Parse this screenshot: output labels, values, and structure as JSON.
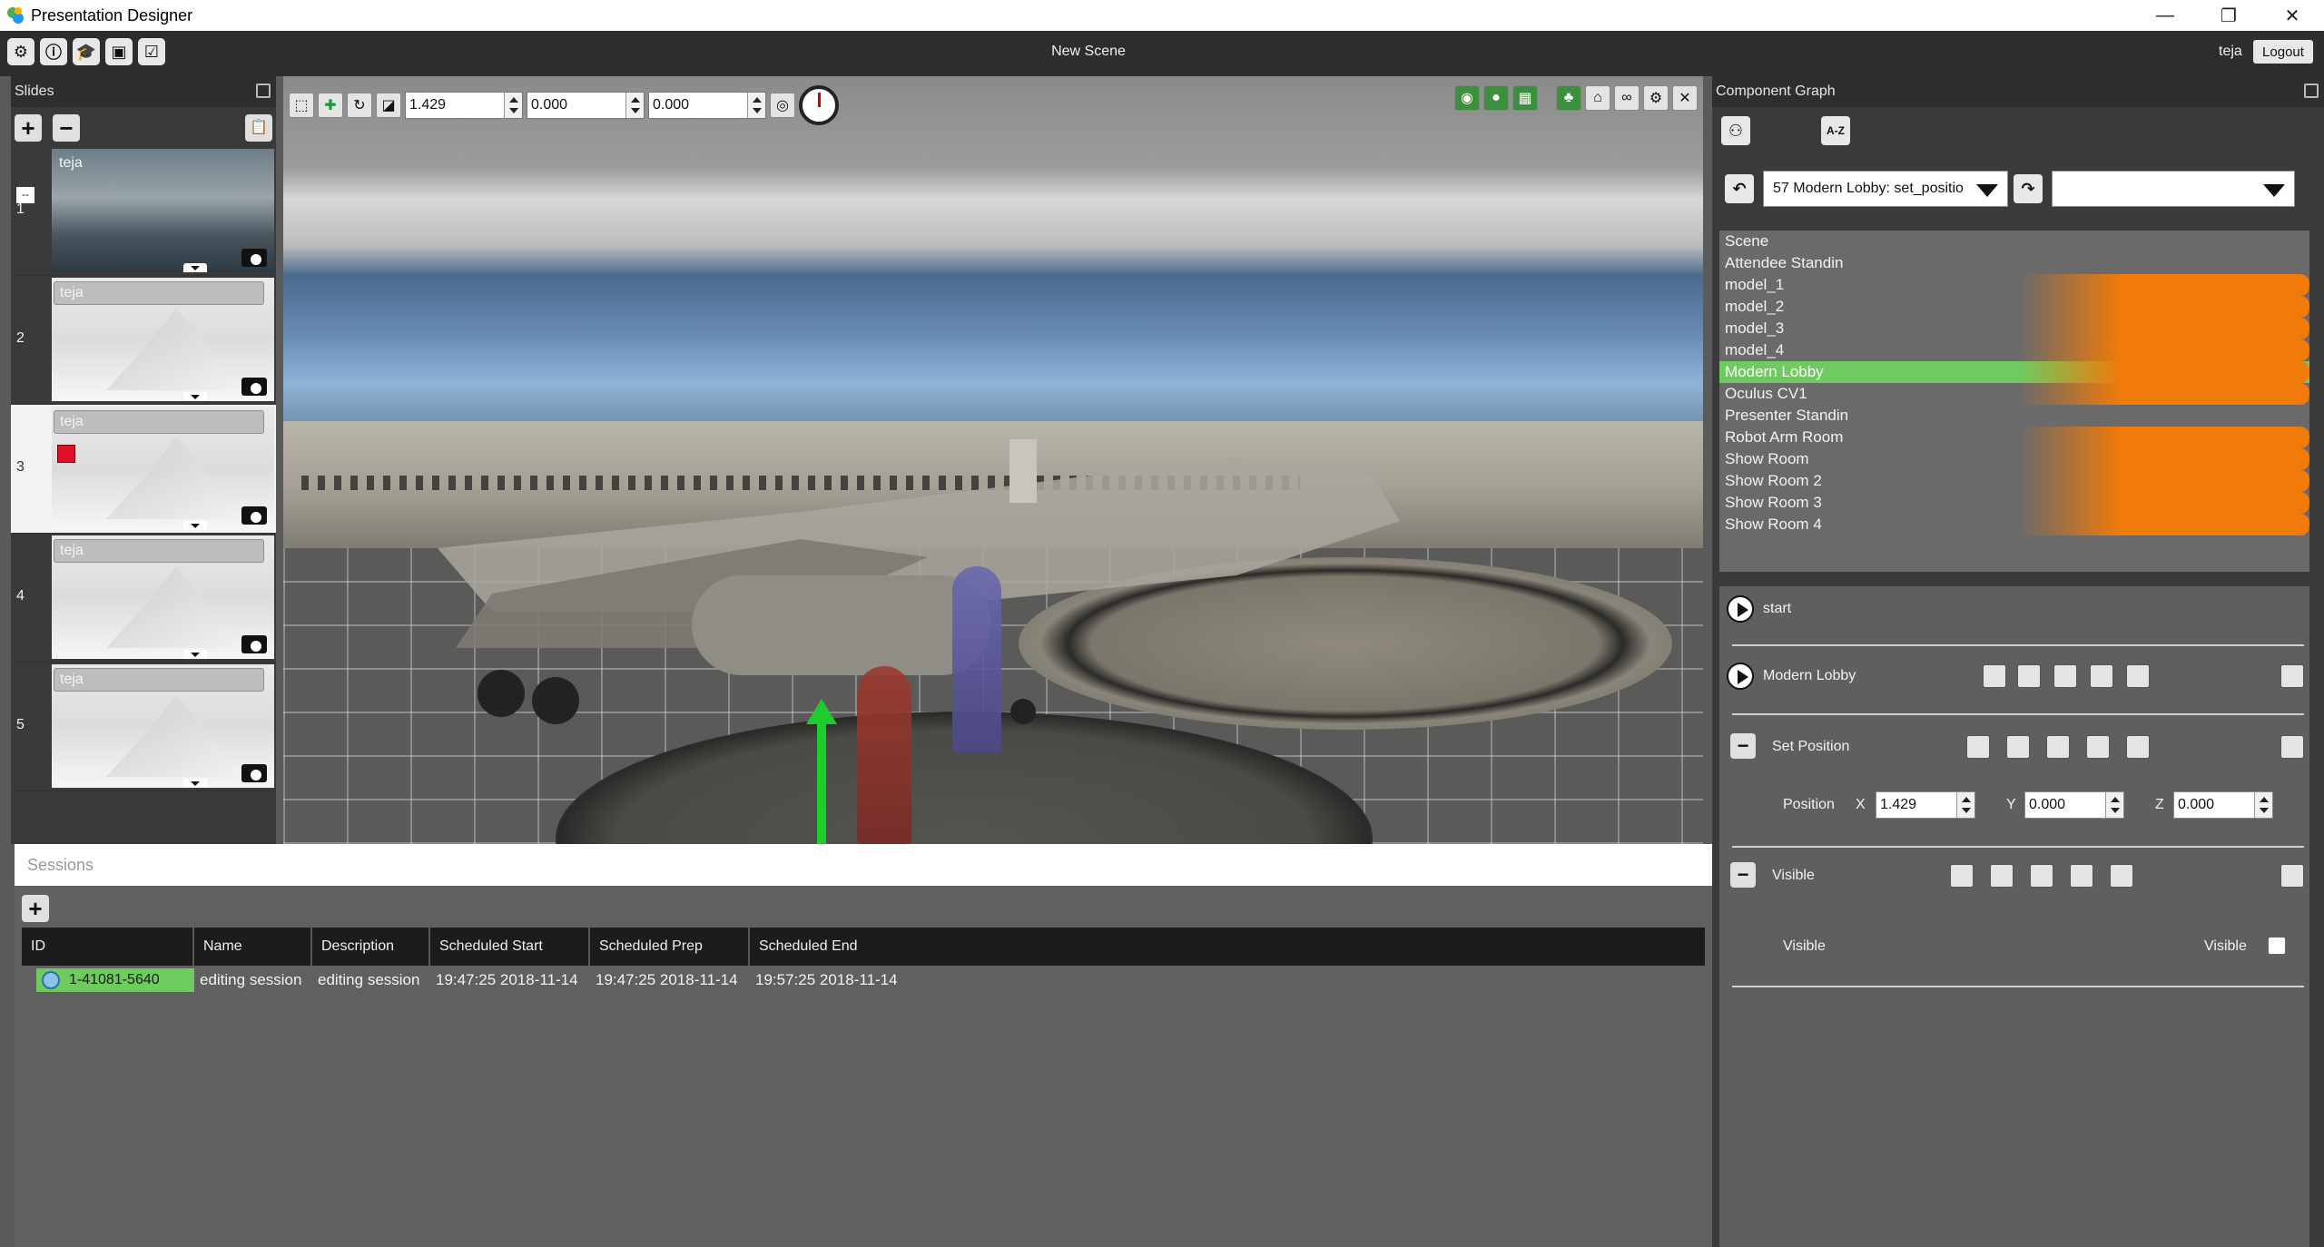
{
  "window": {
    "title": "Presentation Designer",
    "controls": [
      "—",
      "❐",
      "✕"
    ]
  },
  "topbar": {
    "scene_title": "New Scene",
    "username": "teja",
    "logout_label": "Logout",
    "tool_icons": [
      "gear-icon",
      "info-icon",
      "graduation-cap-icon",
      "video-icon",
      "checklist-icon"
    ]
  },
  "slides": {
    "title": "Slides",
    "add_label": "+",
    "remove_label": "−",
    "items": [
      {
        "number": "1",
        "label": "teja",
        "badge": "--"
      },
      {
        "number": "2",
        "label": "teja"
      },
      {
        "number": "3",
        "label": "teja"
      },
      {
        "number": "4",
        "label": "teja"
      },
      {
        "number": "5",
        "label": "teja"
      }
    ]
  },
  "viewport": {
    "pos_x": "1.429",
    "pos_y": "0.000",
    "pos_z": "0.000"
  },
  "sessions": {
    "title": "Sessions",
    "add_label": "+",
    "columns": [
      "ID",
      "Name",
      "Description",
      "Scheduled Start",
      "Scheduled Prep",
      "Scheduled End"
    ],
    "rows": [
      {
        "id": "1-41081-5640",
        "name": "editing session",
        "description": "editing session",
        "start": "19:47:25 2018-11-14",
        "prep": "19:47:25 2018-11-14",
        "end": "19:57:25 2018-11-14"
      }
    ]
  },
  "component_graph": {
    "title": "Component Graph",
    "sort_label": "A-Z",
    "history_value": "57 Modern Lobby: set_positio",
    "second_combo_value": "",
    "items": [
      {
        "label": "Scene",
        "highlight": false
      },
      {
        "label": "Attendee Standin",
        "highlight": false
      },
      {
        "label": "model_1",
        "highlight": true
      },
      {
        "label": "model_2",
        "highlight": true
      },
      {
        "label": "model_3",
        "highlight": true
      },
      {
        "label": "model_4",
        "highlight": true
      },
      {
        "label": "Modern Lobby",
        "highlight": true,
        "selected": true
      },
      {
        "label": "Oculus CV1",
        "highlight": true
      },
      {
        "label": "Presenter Standin",
        "highlight": false
      },
      {
        "label": "Robot Arm Room",
        "highlight": true
      },
      {
        "label": "Show Room",
        "highlight": true
      },
      {
        "label": "Show Room 2",
        "highlight": true
      },
      {
        "label": "Show Room 3",
        "highlight": true
      },
      {
        "label": "Show Room 4",
        "highlight": true
      }
    ],
    "start_label": "start",
    "component_label": "Modern Lobby",
    "set_position_label": "Set Position",
    "position_label": "Position",
    "x_label": "X",
    "x_value": "1.429",
    "y_label": "Y",
    "y_value": "0.000",
    "z_label": "Z",
    "z_value": "0.000",
    "visible_section_label": "Visible",
    "visible_label": "Visible",
    "visible_check_label": "Visible",
    "collapse_label": "−"
  },
  "colors": {
    "accent_green": "#6fca5f",
    "highlight_orange": "#f07a0a"
  }
}
